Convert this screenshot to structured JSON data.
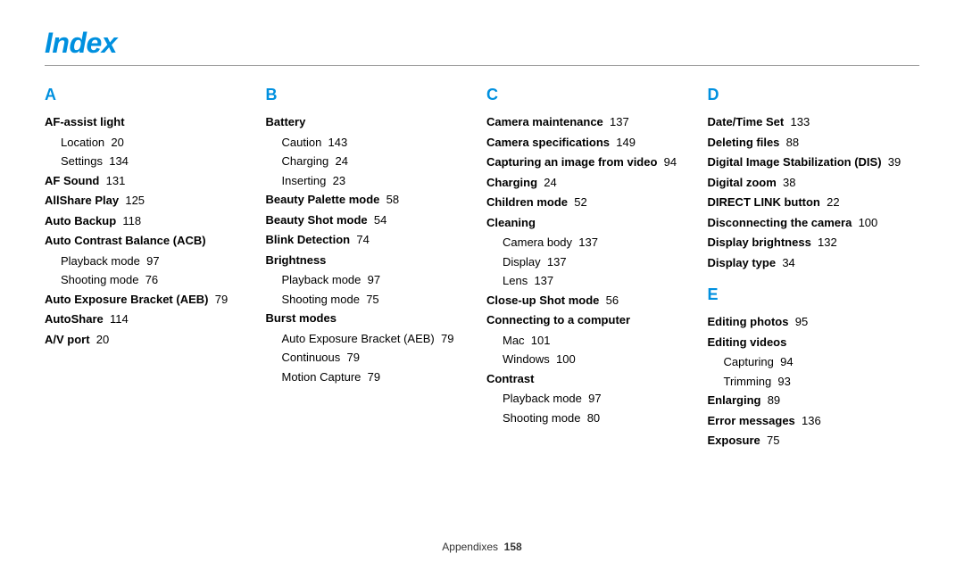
{
  "title": "Index",
  "columns": [
    {
      "sections": [
        {
          "letter": "A",
          "entries": [
            {
              "label": "AF-assist light",
              "bold": true,
              "subs": [
                {
                  "label": "Location",
                  "page": "20"
                },
                {
                  "label": "Settings",
                  "page": "134"
                }
              ]
            },
            {
              "label": "AF Sound",
              "page": "131",
              "bold": true
            },
            {
              "label": "AllShare Play",
              "page": "125",
              "bold": true
            },
            {
              "label": "Auto Backup",
              "page": "118",
              "bold": true
            },
            {
              "label": "Auto Contrast Balance (ACB)",
              "bold": true,
              "subs": [
                {
                  "label": "Playback mode",
                  "page": "97"
                },
                {
                  "label": "Shooting mode",
                  "page": "76"
                }
              ]
            },
            {
              "label": "Auto Exposure Bracket (AEB)",
              "page": "79",
              "bold": true
            },
            {
              "label": "AutoShare",
              "page": "114",
              "bold": true
            },
            {
              "label": "A/V port",
              "page": "20",
              "bold": true
            }
          ]
        }
      ]
    },
    {
      "sections": [
        {
          "letter": "B",
          "entries": [
            {
              "label": "Battery",
              "bold": true,
              "subs": [
                {
                  "label": "Caution",
                  "page": "143"
                },
                {
                  "label": "Charging",
                  "page": "24"
                },
                {
                  "label": "Inserting",
                  "page": "23"
                }
              ]
            },
            {
              "label": "Beauty Palette mode",
              "page": "58",
              "bold": true
            },
            {
              "label": "Beauty Shot mode",
              "page": "54",
              "bold": true
            },
            {
              "label": "Blink Detection",
              "page": "74",
              "bold": true
            },
            {
              "label": "Brightness",
              "bold": true,
              "subs": [
                {
                  "label": "Playback mode",
                  "page": "97"
                },
                {
                  "label": "Shooting mode",
                  "page": "75"
                }
              ]
            },
            {
              "label": "Burst modes",
              "bold": true,
              "subs": [
                {
                  "label": "Auto Exposure Bracket (AEB)",
                  "page": "79"
                },
                {
                  "label": "Continuous",
                  "page": "79"
                },
                {
                  "label": "Motion Capture",
                  "page": "79"
                }
              ]
            }
          ]
        }
      ]
    },
    {
      "sections": [
        {
          "letter": "C",
          "entries": [
            {
              "label": "Camera maintenance",
              "page": "137",
              "bold": true
            },
            {
              "label": "Camera specifications",
              "page": "149",
              "bold": true
            },
            {
              "label": "Capturing an image from video",
              "page": "94",
              "bold": true
            },
            {
              "label": "Charging",
              "page": "24",
              "bold": true
            },
            {
              "label": "Children mode",
              "page": "52",
              "bold": true
            },
            {
              "label": "Cleaning",
              "bold": true,
              "subs": [
                {
                  "label": "Camera body",
                  "page": "137"
                },
                {
                  "label": "Display",
                  "page": "137"
                },
                {
                  "label": "Lens",
                  "page": "137"
                }
              ]
            },
            {
              "label": "Close-up Shot mode",
              "page": "56",
              "bold": true
            },
            {
              "label": "Connecting to a computer",
              "bold": true,
              "subs": [
                {
                  "label": "Mac",
                  "page": "101"
                },
                {
                  "label": "Windows",
                  "page": "100"
                }
              ]
            },
            {
              "label": "Contrast",
              "bold": true,
              "subs": [
                {
                  "label": "Playback mode",
                  "page": "97"
                },
                {
                  "label": "Shooting mode",
                  "page": "80"
                }
              ]
            }
          ]
        }
      ]
    },
    {
      "sections": [
        {
          "letter": "D",
          "entries": [
            {
              "label": "Date/Time Set",
              "page": "133",
              "bold": true
            },
            {
              "label": "Deleting files",
              "page": "88",
              "bold": true
            },
            {
              "label": "Digital Image Stabilization (DIS)",
              "page": "39",
              "bold": true
            },
            {
              "label": "Digital zoom",
              "page": "38",
              "bold": true
            },
            {
              "label": "DIRECT LINK button",
              "page": "22",
              "bold": true
            },
            {
              "label": "Disconnecting the camera",
              "page": "100",
              "bold": true
            },
            {
              "label": "Display brightness",
              "page": "132",
              "bold": true
            },
            {
              "label": "Display type",
              "page": "34",
              "bold": true
            }
          ]
        },
        {
          "letter": "E",
          "spaced": true,
          "entries": [
            {
              "label": "Editing photos",
              "page": "95",
              "bold": true
            },
            {
              "label": "Editing videos",
              "bold": true,
              "subs": [
                {
                  "label": "Capturing",
                  "page": "94"
                },
                {
                  "label": "Trimming",
                  "page": "93"
                }
              ]
            },
            {
              "label": "Enlarging",
              "page": "89",
              "bold": true
            },
            {
              "label": "Error messages",
              "page": "136",
              "bold": true
            },
            {
              "label": "Exposure",
              "page": "75",
              "bold": true
            }
          ]
        }
      ]
    }
  ],
  "footer": {
    "section": "Appendixes",
    "page": "158"
  }
}
